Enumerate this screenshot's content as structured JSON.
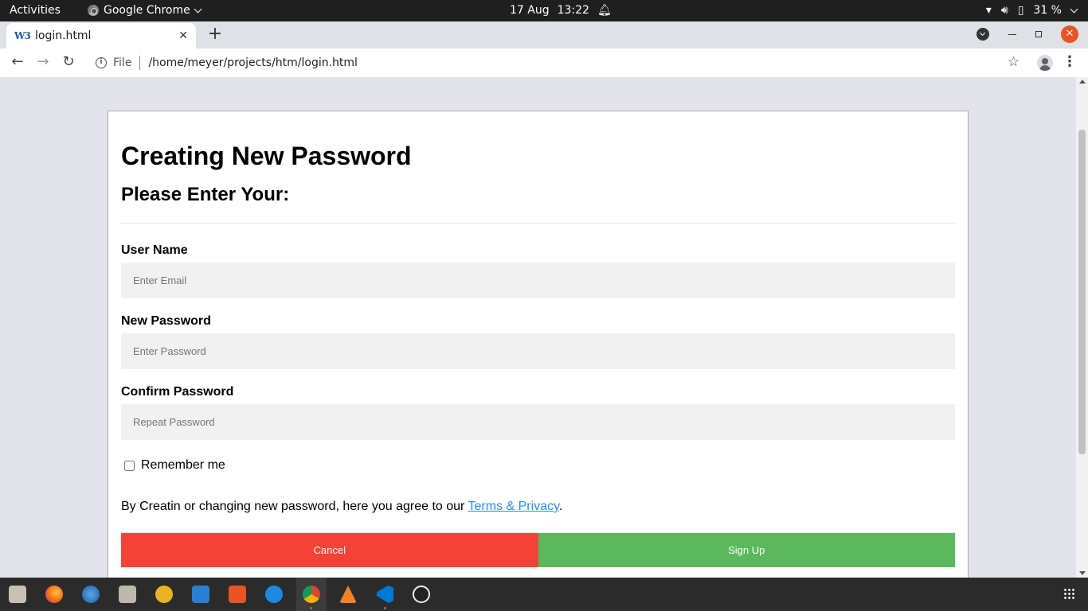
{
  "topbar": {
    "activities": "Activities",
    "app_name": "Google Chrome",
    "date": "17 Aug",
    "time": "13:22",
    "battery": "31 %"
  },
  "browser": {
    "tab_title": "login.html",
    "favicon_text": "W3",
    "file_label": "File",
    "url": "/home/meyer/projects/htm/login.html"
  },
  "form": {
    "heading": "Creating New Password",
    "subheading": "Please Enter Your:",
    "username_label": "User Name",
    "username_placeholder": "Enter Email",
    "password_label": "New Password",
    "password_placeholder": "Enter Password",
    "confirm_label": "Confirm Password",
    "confirm_placeholder": "Repeat Password",
    "remember_label": "Remember me",
    "remember_checked": false,
    "terms_prefix": "By Creatin or changing new password, here you agree to our ",
    "terms_link": "Terms & Privacy",
    "terms_suffix": ".",
    "cancel_label": "Cancel",
    "signup_label": "Sign Up"
  },
  "colors": {
    "cancel": "#f44336",
    "signup": "#5cb85c",
    "link": "#1e90ff",
    "page_bg": "#e3e3ec"
  },
  "dock": {
    "apps": [
      "files-alt-icon",
      "firefox-icon",
      "thunderbird-icon",
      "files-icon",
      "rhythmbox-icon",
      "writer-icon",
      "software-icon",
      "help-icon",
      "chrome-icon",
      "vlc-icon",
      "vscode-icon",
      "obs-icon"
    ]
  }
}
